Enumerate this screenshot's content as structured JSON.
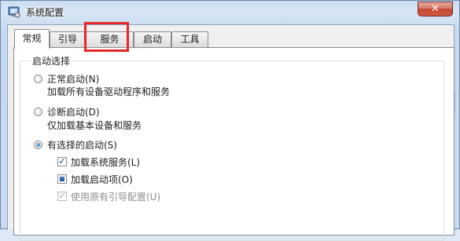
{
  "window": {
    "title": "系统配置",
    "close_glyph": "✕"
  },
  "tabs": [
    {
      "label": "常规",
      "active": true
    },
    {
      "label": "引导",
      "active": false
    },
    {
      "label": "服务",
      "active": false
    },
    {
      "label": "启动",
      "active": false
    },
    {
      "label": "工具",
      "active": false
    }
  ],
  "startup_group": {
    "legend": "启动选择",
    "options": [
      {
        "label": "正常启动(N)",
        "description": "加载所有设备驱动程序和服务",
        "selected": false
      },
      {
        "label": "诊断启动(D)",
        "description": "仅加载基本设备和服务",
        "selected": false
      },
      {
        "label": "有选择的启动(S)",
        "selected": true
      }
    ],
    "sub_options": [
      {
        "label": "加载系统服务(L)",
        "state": "checked",
        "enabled": true
      },
      {
        "label": "加载启动项(O)",
        "state": "indeterminate",
        "enabled": true
      },
      {
        "label": "使用原有引导配置(U)",
        "state": "checked",
        "enabled": false
      }
    ]
  },
  "annotation": {
    "highlight_color": "#e8262a",
    "target": "服务"
  },
  "icons": {
    "app": "system-config-icon",
    "close": "close-icon"
  }
}
